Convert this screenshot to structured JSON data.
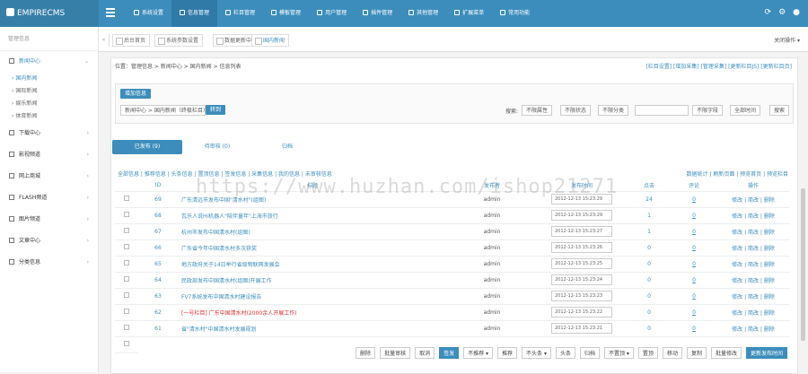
{
  "app": {
    "logo": "EMPIRECMS"
  },
  "nav": [
    {
      "label": "系统设置",
      "active": false
    },
    {
      "label": "信息管理",
      "active": true
    },
    {
      "label": "栏目管理",
      "active": false
    },
    {
      "label": "模板管理",
      "active": false
    },
    {
      "label": "用户管理",
      "active": false
    },
    {
      "label": "插件管理",
      "active": false
    },
    {
      "label": "其他管理",
      "active": false
    },
    {
      "label": "扩展菜单",
      "active": false
    },
    {
      "label": "常用功能",
      "active": false
    }
  ],
  "sidebar": {
    "title": "管理信息",
    "items": [
      {
        "label": "新闻中心",
        "open": true,
        "subs": [
          {
            "label": "国内新闻",
            "active": true
          },
          {
            "label": "国际新闻",
            "active": false
          },
          {
            "label": "娱乐新闻",
            "active": false
          },
          {
            "label": "体育新闻",
            "active": false
          }
        ]
      },
      {
        "label": "下载中心"
      },
      {
        "label": "影视频道"
      },
      {
        "label": "网上商城"
      },
      {
        "label": "FLASH频道"
      },
      {
        "label": "图片频道"
      },
      {
        "label": "文章中心"
      },
      {
        "label": "分类信息"
      }
    ]
  },
  "tabstrip": {
    "tabs": [
      {
        "label": "后台首页",
        "active": false
      },
      {
        "label": "系统参数设置",
        "active": false
      },
      {
        "label": "数据更新中心",
        "active": false
      },
      {
        "label": "国内新闻",
        "active": true
      }
    ],
    "close_label": "关闭操作 ▾"
  },
  "crumb": {
    "text": "位置：管理信息 > 新闻中心 > 国内新闻 > 信息列表",
    "links": "[栏目设置] [增加采集] [管理采集] [更新栏目JS] [更新栏目页]"
  },
  "toolbar": {
    "add_button": "增加信息",
    "category_select": "新闻中心 > 国内新闻（终极栏目）",
    "go_button": "转到",
    "search_label": "搜索:",
    "search_selects": [
      "不限属性",
      "不限状态",
      "不限分类",
      "标题",
      "不限字段",
      "全部时间"
    ],
    "search_button": "搜索"
  },
  "tabs2": [
    {
      "label": "已发布 (9)",
      "active": true
    },
    {
      "label": "待审核 (0)",
      "active": false
    },
    {
      "label": "归档",
      "active": false
    }
  ],
  "filters": "全部信息 | 推荐信息 | 头条信息 | 置顶信息 | 签发信息 | 采集信息 | 我的信息 | 未审核信息",
  "right_links": "数据统计 | 刷新页面 | 预览首页 | 预览栏目",
  "table": {
    "headers": [
      "",
      "ID",
      "标题",
      "发布者",
      "发布时间",
      "点击",
      "评论",
      "操作"
    ],
    "rows": [
      {
        "id": "69",
        "title": "广东清远市发布中国\"清水村\"(组图)",
        "author": "admin",
        "time": "2012-12-13 15:23:29",
        "clicks": "24",
        "comments": "0",
        "ops": "修改 | 简改 | 删除",
        "red": false
      },
      {
        "id": "68",
        "title": "瓦乐人说Hi机器人\"陪伴童年\"上海市旅行",
        "author": "admin",
        "time": "2012-12-13 15:23:29",
        "clicks": "1",
        "comments": "0",
        "ops": "修改 | 简改 | 删除",
        "red": false
      },
      {
        "id": "67",
        "title": "杭州市发布中国清水村(组图)",
        "author": "admin",
        "time": "2012-12-13 15:23:27",
        "clicks": "1",
        "comments": "0",
        "ops": "修改 | 简改 | 删除",
        "red": false
      },
      {
        "id": "66",
        "title": "广东省今年中国清水村多次获奖",
        "author": "admin",
        "time": "2012-12-13 15:23:26",
        "clicks": "0",
        "comments": "0",
        "ops": "修改 | 简改 | 删除",
        "red": false
      },
      {
        "id": "65",
        "title": "地方政府关于14日举行省级物联网发展会",
        "author": "admin",
        "time": "2012-12-13 15:23:25",
        "clicks": "0",
        "comments": "0",
        "ops": "修改 | 简改 | 删除",
        "red": false
      },
      {
        "id": "64",
        "title": "民政部发布中国清水村(组图)开展工作",
        "author": "admin",
        "time": "2012-12-13 15:23:24",
        "clicks": "0",
        "comments": "0",
        "ops": "修改 | 简改 | 删除",
        "red": false
      },
      {
        "id": "63",
        "title": "FV7系统发布中国清水村建设报告",
        "author": "admin",
        "time": "2012-12-13 15:23:23",
        "clicks": "0",
        "comments": "0",
        "ops": "修改 | 简改 | 删除",
        "red": false
      },
      {
        "id": "62",
        "title": "[一号栏目] 广东中国清水村(2000余人开展工作)",
        "author": "admin",
        "time": "2012-12-13 15:23:22",
        "clicks": "0",
        "comments": "0",
        "ops": "修改 | 简改 | 删除",
        "red": true
      },
      {
        "id": "61",
        "title": "省\"清水村\"中国清水村发展规划",
        "author": "admin",
        "time": "2012-12-13 15:23:21",
        "clicks": "0",
        "comments": "0",
        "ops": "修改 | 简改 | 删除",
        "red": false
      }
    ]
  },
  "bottom_buttons": [
    "删除",
    "批量审核",
    "取消",
    "签发",
    "不推荐 ▾",
    "推荐",
    "不头条 ▾",
    "头条",
    "归档",
    "不置顶 ▾",
    "置顶",
    "移动",
    "复制",
    "批量修改",
    "更新发布时间"
  ],
  "paging": "共 9 条记录 ▾ 管理员",
  "watermark": "https://www.huzhan.com/ishop21271"
}
